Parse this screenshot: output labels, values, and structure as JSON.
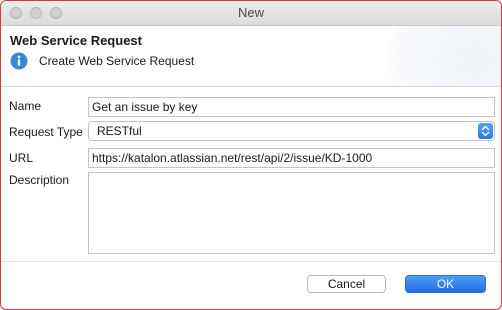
{
  "window": {
    "title": "New"
  },
  "header": {
    "title": "Web Service Request",
    "message": "Create Web Service Request",
    "icon": "info-icon"
  },
  "form": {
    "name_label": "Name",
    "name_value": "Get an issue by key",
    "request_type_label": "Request Type",
    "request_type_value": "RESTful",
    "url_label": "URL",
    "url_value": "https://katalon.atlassian.net/rest/api/2/issue/KD-1000",
    "description_label": "Description",
    "description_value": ""
  },
  "buttons": {
    "cancel_label": "Cancel",
    "ok_label": "OK"
  },
  "colors": {
    "accent": "#2a78e2",
    "window_border": "#d9363e",
    "info_icon": "#3a86d6"
  }
}
